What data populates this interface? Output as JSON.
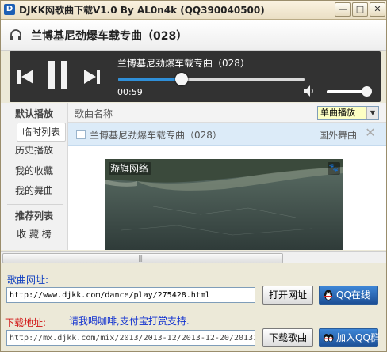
{
  "window": {
    "title": "DJKK网歌曲下载V1.0 By AL0n4k (QQ390040500)",
    "minimize": "—",
    "maximize": "□",
    "close": "✕",
    "app_icon": "D"
  },
  "now_playing": {
    "title": "兰博基尼劲爆车载专曲（028）",
    "icon": "headphone-icon"
  },
  "player": {
    "track_title": "兰博基尼劲爆车载专曲（028）",
    "elapsed": "00:59",
    "progress_fraction": 0.34,
    "volume_fraction": 0.9,
    "accent_color": "#2f8fd8",
    "background": "#323232"
  },
  "sidebar": {
    "section1": "默认播放",
    "items1": [
      "临时列表",
      "历史播放",
      "我的收藏",
      "我的舞曲"
    ],
    "active_index": 0,
    "section2": "推荐列表",
    "items2": [
      "收 藏 榜"
    ]
  },
  "list": {
    "column_name": "歌曲名称",
    "mode_select": "单曲播放",
    "rows": [
      {
        "title": "兰博基尼劲爆车载专曲（028）",
        "category": "国外舞曲",
        "delete": "✕"
      }
    ]
  },
  "ad": {
    "logo": "游旗网络",
    "badge": "🐾"
  },
  "scrollbar": {
    "grip": "|||"
  },
  "bottom": {
    "song_url_label": "歌曲网址:",
    "song_url_value": "http://www.djkk.com/dance/play/275428.html",
    "open_url_button": "打开网址",
    "qq_online_button": "QQ在线",
    "download_label": "下载地址:",
    "donate_text": "请我喝咖啡,支付宝打赏支持.",
    "download_url_value": "http://mx.djkk.com/mix/2013/2013-12/2013-12-20/20131",
    "download_button": "下载歌曲",
    "qq_group_button": "加入QQ群"
  }
}
